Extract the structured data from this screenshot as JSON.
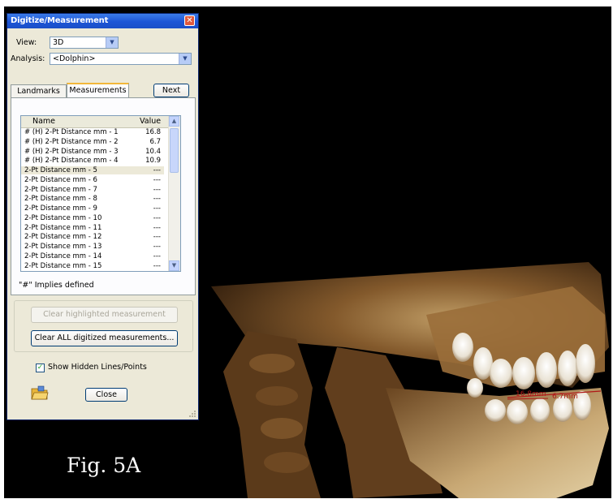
{
  "dialog": {
    "title": "Digitize/Measurement",
    "view_label": "View:",
    "view_value": "3D",
    "analysis_label": "Analysis:",
    "analysis_value": "<Dolphin>",
    "tabs": [
      {
        "label": "Landmarks"
      },
      {
        "label": "Measurements"
      }
    ],
    "next_label": "Next",
    "columns": {
      "name": "Name",
      "value": "Value"
    },
    "rows": [
      {
        "name": "# (H) 2-Pt Distance mm - 1",
        "value": "16.8"
      },
      {
        "name": "# (H) 2-Pt Distance mm - 2",
        "value": "6.7"
      },
      {
        "name": "# (H) 2-Pt Distance mm - 3",
        "value": "10.4"
      },
      {
        "name": "# (H) 2-Pt Distance mm - 4",
        "value": "10.9"
      },
      {
        "name": "2-Pt Distance mm - 5",
        "value": "---"
      },
      {
        "name": "2-Pt Distance mm - 6",
        "value": "---"
      },
      {
        "name": "2-Pt Distance mm - 7",
        "value": "---"
      },
      {
        "name": "2-Pt Distance mm - 8",
        "value": "---"
      },
      {
        "name": "2-Pt Distance mm - 9",
        "value": "---"
      },
      {
        "name": "2-Pt Distance mm - 10",
        "value": "---"
      },
      {
        "name": "2-Pt Distance mm - 11",
        "value": "---"
      },
      {
        "name": "2-Pt Distance mm - 12",
        "value": "---"
      },
      {
        "name": "2-Pt Distance mm - 13",
        "value": "---"
      },
      {
        "name": "2-Pt Distance mm - 14",
        "value": "---"
      },
      {
        "name": "2-Pt Distance mm - 15",
        "value": "---"
      }
    ],
    "selected_row": "2-Pt Distance mm - 5",
    "note": "\"#\" Implies defined",
    "clear_highlighted_label": "Clear highlighted measurement",
    "clear_all_label": "Clear ALL digitized measurements...",
    "show_hidden_label": "Show Hidden Lines/Points",
    "show_hidden_checked": true,
    "close_label": "Close",
    "icons": [
      "close-icon",
      "chevron-down-icon",
      "scroll-up-icon",
      "scroll-down-icon",
      "folder-icon",
      "check-icon"
    ]
  },
  "scan": {
    "measurement_labels": [
      "16.8mm",
      "6.7mm"
    ],
    "measurement_color": "#b01818"
  },
  "figure_label": "Fig. 5A",
  "colors": {
    "background": "#000000",
    "titlebar": "#1c55d6",
    "dialog_face": "#ece9d8",
    "bone": "#c9a46a"
  }
}
